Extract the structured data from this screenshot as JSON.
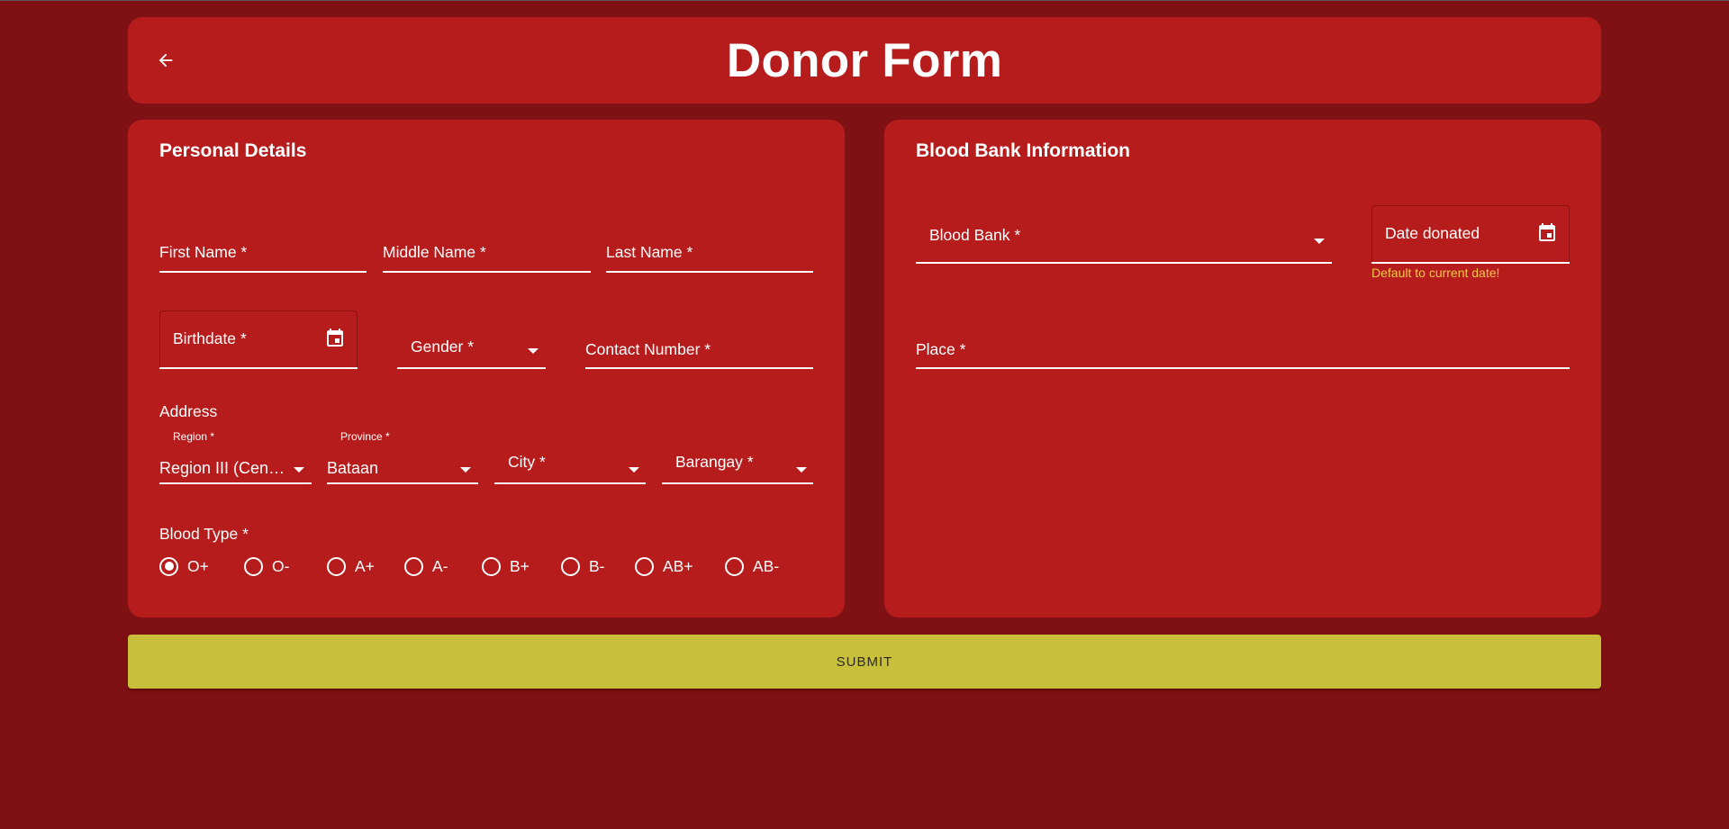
{
  "header": {
    "title": "Donor Form",
    "back_icon": "arrow-left-icon"
  },
  "personal": {
    "title": "Personal Details",
    "first_name": "First Name *",
    "middle_name": "Middle Name *",
    "last_name": "Last Name *",
    "birthdate": "Birthdate *",
    "gender": "Gender *",
    "contact": "Contact Number *",
    "address": {
      "label": "Address",
      "region_label": "Region *",
      "region_value": "Region III (Central Luzon)",
      "province_label": "Province *",
      "province_value": "Bataan",
      "city": "City *",
      "barangay": "Barangay *"
    },
    "blood_type": {
      "label": "Blood Type *",
      "options": [
        "O+",
        "O-",
        "A+",
        "A-",
        "B+",
        "B-",
        "AB+",
        "AB-"
      ],
      "selected": "O+"
    }
  },
  "bloodbank": {
    "title": "Blood Bank Information",
    "bank_label": "Blood Bank *",
    "date_label": "Date donated",
    "date_helper": "Default to current date!",
    "place_label": "Place *"
  },
  "submit_label": "SUBMIT",
  "colors": {
    "background": "#7f1114",
    "card": "#b71c1c",
    "submit": "#c8bf3a",
    "helper": "#f3c84a"
  }
}
